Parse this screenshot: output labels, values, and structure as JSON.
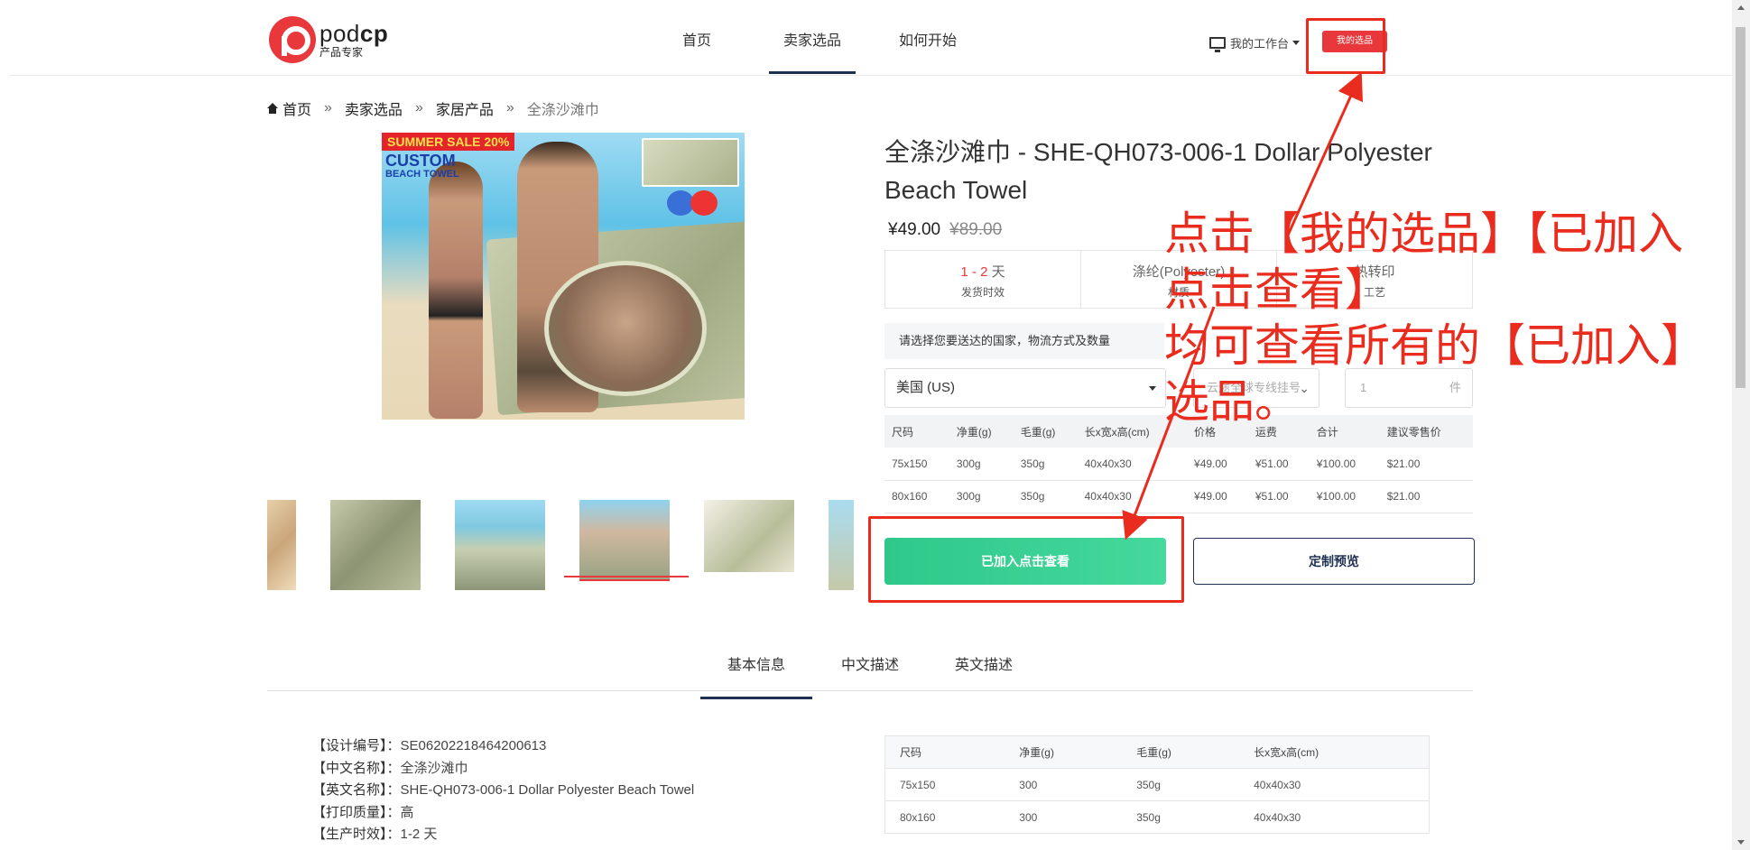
{
  "header": {
    "logo_word_a": "pod",
    "logo_word_b": "cp",
    "logo_sub": "产品专家",
    "nav": [
      "首页",
      "卖家选品",
      "如何开始"
    ],
    "workbench_label": "我的工作台",
    "my_products_label": "我的选品"
  },
  "breadcrumb": {
    "items": [
      "首页",
      "卖家选品",
      "家居产品"
    ],
    "current": "全涤沙滩巾",
    "separator": "»"
  },
  "main_image": {
    "sale_text": "SUMMER SALE 20%",
    "custom_text": "CUSTOM",
    "custom_sub": "BEACH TOWEL"
  },
  "product": {
    "title": "全涤沙滩巾 - SHE-QH073-006-1 Dollar Polyester Beach Towel",
    "price": "¥49.00",
    "price_old": "¥89.00",
    "stats": [
      {
        "value_pre": "1 - 2",
        "value_post": " 天",
        "label": "发货时效"
      },
      {
        "value": "涤纶(Polyester)",
        "label": "材质"
      },
      {
        "value": "热转印",
        "label": "工艺"
      }
    ],
    "select_hint": "请选择您要送达的国家，物流方式及数量",
    "country": "美国 (US)",
    "shipping_placeholder": "云途全球专线挂号",
    "qty": "1",
    "qty_unit": "件",
    "size_table": {
      "headers": [
        "尺码",
        "净重(g)",
        "毛重(g)",
        "长x宽x高(cm)",
        "价格",
        "运费",
        "合计",
        "建议零售价"
      ],
      "rows": [
        [
          "75x150",
          "300g",
          "350g",
          "40x40x30",
          "¥49.00",
          "¥51.00",
          "¥100.00",
          "$21.00"
        ],
        [
          "80x160",
          "300g",
          "350g",
          "40x40x30",
          "¥49.00",
          "¥51.00",
          "¥100.00",
          "$21.00"
        ]
      ]
    },
    "added_button": "已加入点击查看",
    "preview_button": "定制预览"
  },
  "tabs": [
    "基本信息",
    "中文描述",
    "英文描述"
  ],
  "info": [
    {
      "k": "【设计编号】：",
      "v": "SE06202218464200613"
    },
    {
      "k": "【中文名称】：",
      "v": "全涤沙滩巾"
    },
    {
      "k": "【英文名称】：",
      "v": "SHE-QH073-006-1 Dollar Polyester Beach Towel"
    },
    {
      "k": "【打印质量】：",
      "v": "高"
    },
    {
      "k": "【生产时效】：",
      "v": "1-2 天"
    }
  ],
  "spec_table": {
    "headers": [
      "尺码",
      "净重(g)",
      "毛重(g)",
      "长x宽x高(cm)"
    ],
    "rows": [
      [
        "75x150",
        "300",
        "350g",
        "40x40x30"
      ],
      [
        "80x160",
        "300",
        "350g",
        "40x40x30"
      ]
    ]
  },
  "annotation": {
    "line1": "点击【我的选品】【已加入",
    "line2": "点击查看】",
    "line3": "均可查看所有的【已加入】",
    "line4": "选品。"
  },
  "colors": {
    "brand_red": "#e8383b",
    "annotation_red": "#ea2c1f",
    "green": "#2ec98a",
    "navy": "#1f2f52"
  }
}
